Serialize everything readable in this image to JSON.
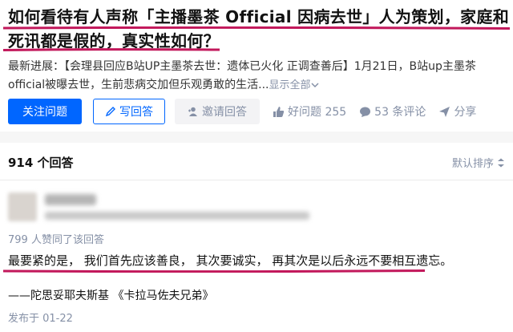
{
  "question": {
    "title_line1": "如何看待有人声称「主播墨茶 Official 因病去世」人为策划，家庭和",
    "title_line2": "死讯都是假的，真实性如何？",
    "excerpt_line1": "最新进展：【会理县回应B站UP主墨茶去世：遗体已火化 正调查善后】1月21日，B站up主墨茶",
    "excerpt_line2": "official被曝去世，生前悲病交加但乐观勇敢的生活...",
    "show_all": "显示全部",
    "show_all_icon": "chevron-down-icon"
  },
  "actions": {
    "follow_label": "关注问题",
    "write_label": "写回答",
    "invite_label": "邀请回答",
    "good_question": "好问题 255",
    "comments": "53 条评论",
    "share": "分享"
  },
  "answers": {
    "count_label": "914 个回答",
    "sort_label": "默认排序",
    "first": {
      "upvotes": "799 人赞同了该回答",
      "content": "最要紧的是， 我们首先应该善良， 其次要诚实， 再其次是以后永远不要相互遗忘。",
      "quote": "——陀思妥耶夫斯基 《卡拉马佐夫兄弟》",
      "published": "发布于 01-22"
    }
  },
  "colors": {
    "accent": "#0066ff",
    "highlight_mark": "#c2185b",
    "muted": "#8590a6"
  }
}
